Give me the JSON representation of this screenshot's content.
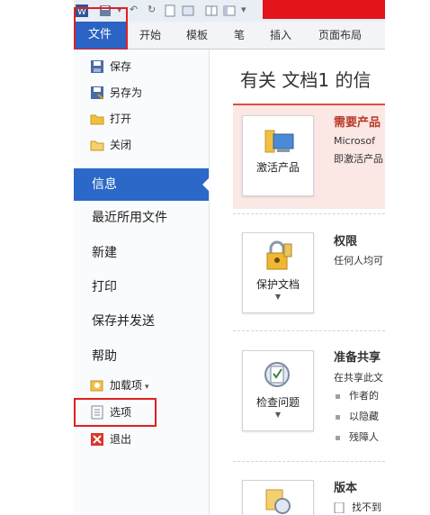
{
  "ribbon": {
    "tabs": [
      "文件",
      "开始",
      "模板",
      "笔",
      "插入",
      "页面布局"
    ]
  },
  "menu": {
    "save": "保存",
    "save_as": "另存为",
    "open": "打开",
    "close": "关闭",
    "info": "信息",
    "recent": "最近所用文件",
    "new": "新建",
    "print": "打印",
    "save_send": "保存并发送",
    "help": "帮助",
    "addins": "加载项",
    "options": "选项",
    "exit": "退出"
  },
  "main": {
    "title": "有关 文档1 的信",
    "activate": {
      "button": "激活产品",
      "heading": "需要产品",
      "line1": "Microsof",
      "line2": "即激活产品"
    },
    "protect": {
      "button": "保护文档",
      "heading": "权限",
      "text": "任何人均可"
    },
    "inspect": {
      "button": "检查问题",
      "heading": "准备共享",
      "text": "在共享此文",
      "bullets": [
        "作者的",
        "以隐藏",
        "残障人"
      ]
    },
    "versions": {
      "heading": "版本",
      "text": "找不到"
    }
  },
  "colors": {
    "file_tab": "#2a63c3",
    "info_selected": "#2b68c7",
    "highlight_outline": "#e0201f",
    "warning_bg": "#fbe7e4"
  }
}
